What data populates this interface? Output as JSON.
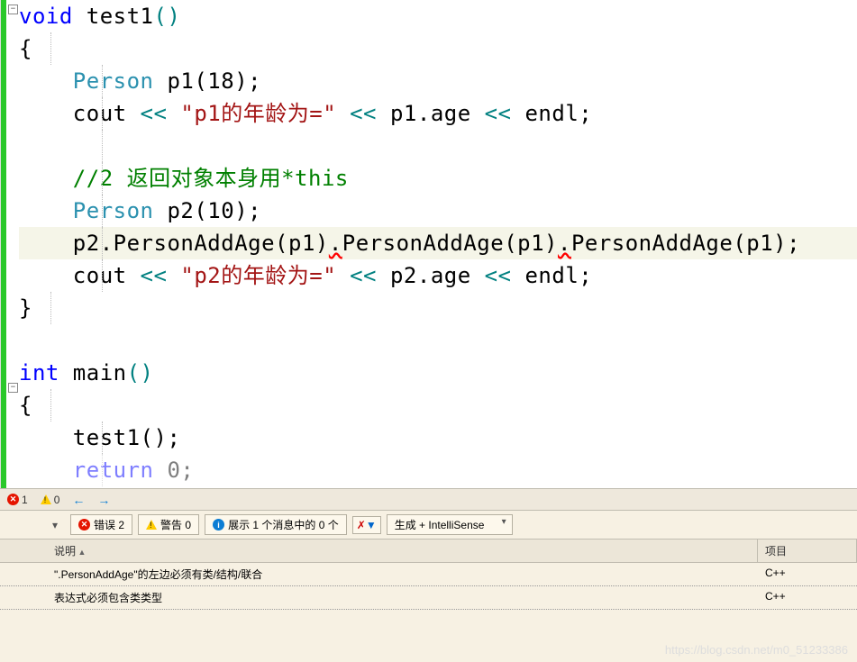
{
  "code": {
    "l1_void": "void",
    "l1_name": " test1",
    "l1_paren": "()",
    "l2": "{",
    "l3_type": "    Person",
    "l3_rest": " p1(18);",
    "l4_a": "    cout ",
    "l4_op1": "<<",
    "l4_str": " \"p1的年龄为=\" ",
    "l4_op2": "<<",
    "l4_b": " p1.age ",
    "l4_op3": "<<",
    "l4_c": " endl;",
    "l5": " ",
    "l6_cmt": "    //2 返回对象本身用*this",
    "l7_type": "    Person",
    "l7_rest": " p2(10);",
    "l8_a": "    p2.",
    "l8_m": "PersonAddAge",
    "l8_b": "(p1)",
    "l8_dot1": ".",
    "l8_m2": "PersonAddAge",
    "l8_c": "(p1)",
    "l8_dot2": ".",
    "l8_m3": "PersonAddAge",
    "l8_d": "(p1);",
    "l9_a": "    cout ",
    "l9_op1": "<<",
    "l9_str": " \"p2的年龄为=\" ",
    "l9_op2": "<<",
    "l9_b": " p2.age ",
    "l9_op3": "<<",
    "l9_c": " endl;",
    "l10": "}",
    "l11": " ",
    "l12_int": "int",
    "l12_name": " main",
    "l12_paren": "()",
    "l13": "{",
    "l14": "    test1();",
    "l15_ret": "    return",
    "l15_rest": " 0;"
  },
  "statusbar": {
    "errcount": "1",
    "warncount": "0"
  },
  "toolbar": {
    "errors_label": "错误 2",
    "warnings_label": "警告 0",
    "messages_label": "展示 1 个消息中的 0 个",
    "combo_value": "生成 + IntelliSense"
  },
  "table": {
    "col_desc": "说明",
    "col_proj": "项目",
    "rows": [
      {
        "desc": "\".PersonAddAge\"的左边必须有类/结构/联合",
        "proj": "C++"
      },
      {
        "desc": "表达式必须包含类类型",
        "proj": "C++"
      }
    ]
  },
  "watermark": "https://blog.csdn.net/m0_51233386"
}
